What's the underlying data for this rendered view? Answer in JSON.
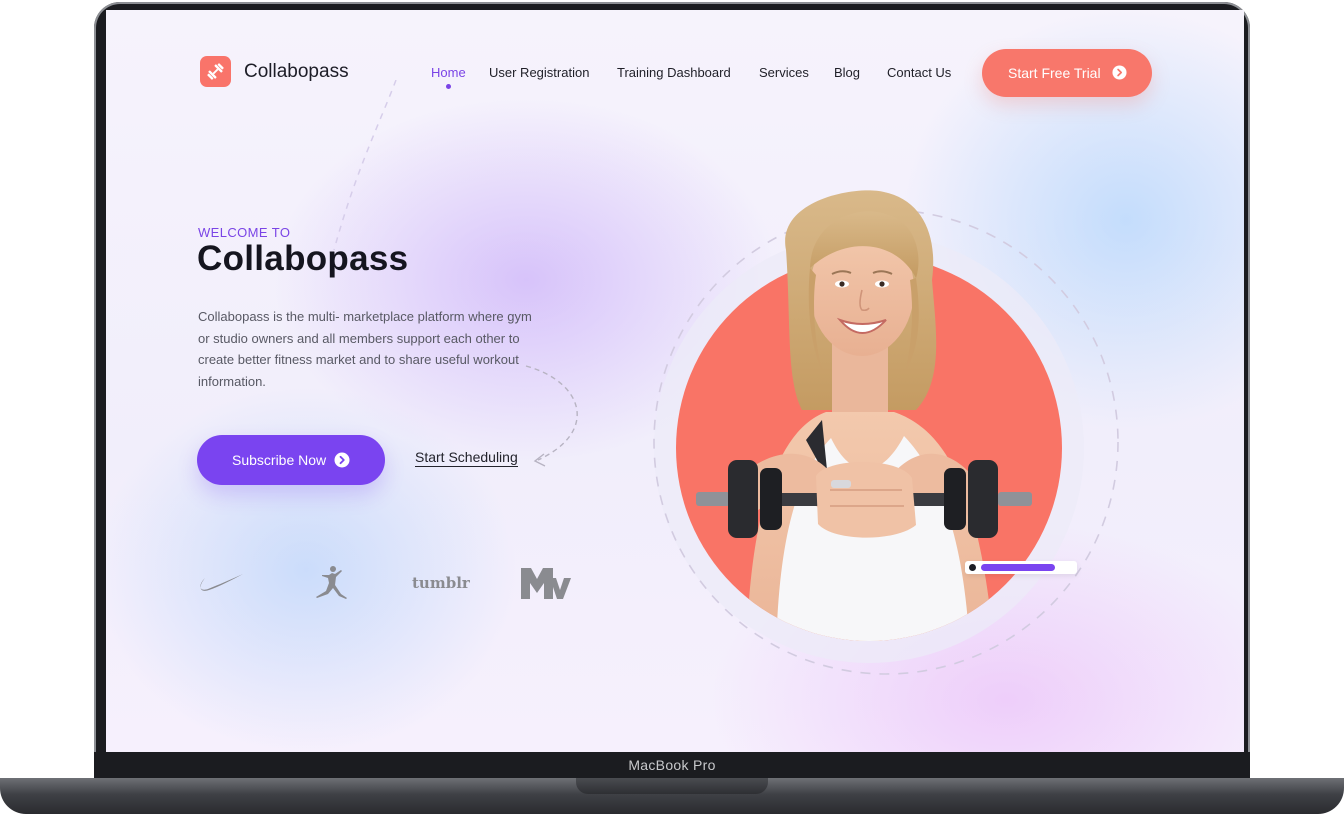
{
  "device": {
    "label": "MacBook Pro"
  },
  "header": {
    "brand": "Collabopass",
    "nav": [
      {
        "label": "Home",
        "active": true
      },
      {
        "label": "User Registration",
        "active": false
      },
      {
        "label": "Training Dashboard",
        "active": false
      },
      {
        "label": "Services",
        "active": false
      },
      {
        "label": "Blog",
        "active": false
      },
      {
        "label": "Contact Us",
        "active": false
      }
    ],
    "cta_label": "Start Free Trial"
  },
  "hero": {
    "eyebrow": "WELCOME TO",
    "title": "Collabopass",
    "description": "Collabopass is the multi- marketplace platform where gym or studio owners and all members support each other to create better fitness market and to share useful workout information.",
    "primary_button": "Subscribe Now",
    "secondary_link": "Start Scheduling",
    "partners": [
      {
        "name": "Nike",
        "icon": "nike-swoosh-icon"
      },
      {
        "name": "Jordan",
        "icon": "jumpman-icon"
      },
      {
        "name": "tumblr",
        "icon": "tumblr-wordmark"
      },
      {
        "name": "MTV",
        "icon": "mtv-logo"
      }
    ],
    "image": {
      "icon": "woman-with-dumbbell-photo"
    },
    "slider_progress": 0.8
  },
  "colors": {
    "primary": "#7a44f0",
    "coral": "#f8776b",
    "text_dark": "#15151f"
  }
}
